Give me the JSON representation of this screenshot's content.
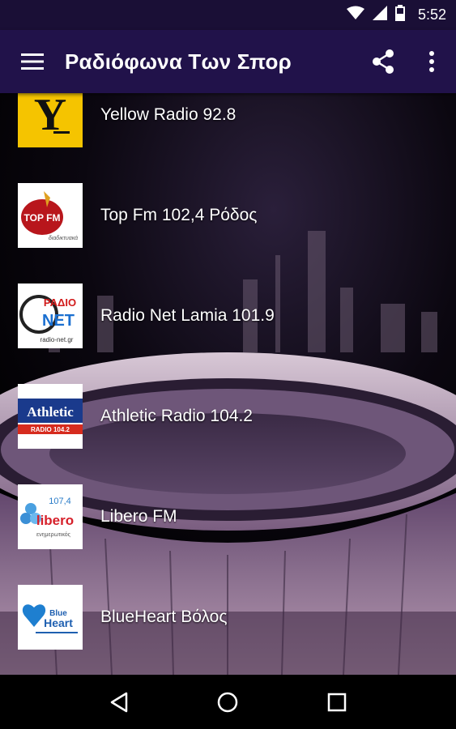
{
  "status_bar": {
    "time": "5:52"
  },
  "app_bar": {
    "title": "Ραδιόφωνα Των Σπορ"
  },
  "stations": [
    {
      "name": "Yellow Radio 92.8",
      "logo_text": "Y"
    },
    {
      "name": "Top Fm 102,4 Ρόδος",
      "logo_text": "TOP FM",
      "logo_subtext": "διαδικτυακά"
    },
    {
      "name": "Radio Net Lamia 101.9",
      "logo_text": "ΡΑΔΙΟ",
      "logo_text2": "NET",
      "logo_subtext": "radio-net.gr"
    },
    {
      "name": "Athletic Radio 104.2",
      "logo_text": "Athletic",
      "logo_subtext": "RADIO 104.2"
    },
    {
      "name": "Libero FM",
      "logo_text": "libero",
      "logo_freq": "107,4",
      "logo_subtext": "ενημερωτικός"
    },
    {
      "name": "BlueHeart Βόλος",
      "logo_text": "Blue",
      "logo_text2": "Heart"
    }
  ],
  "colors": {
    "app_bar": "#21124a",
    "status_bar": "#1a0f36",
    "nav_bar": "#000000"
  }
}
